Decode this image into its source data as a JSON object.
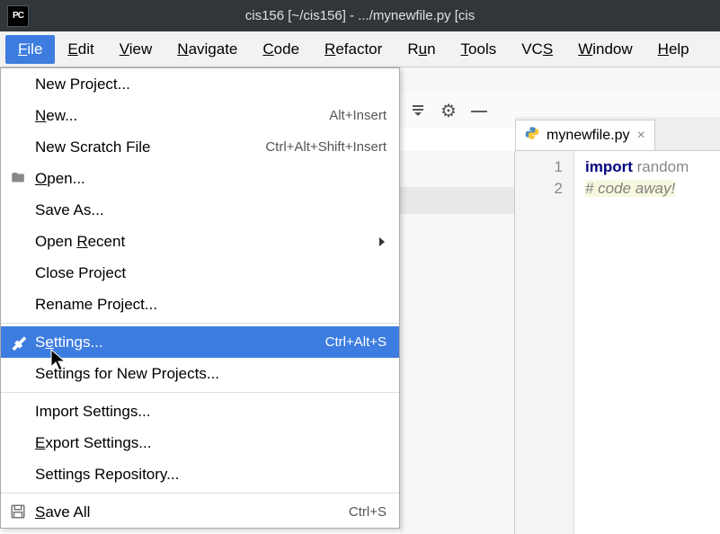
{
  "titlebar": {
    "app_icon_text": "PC",
    "text": "cis156 [~/cis156] - .../mynewfile.py [cis"
  },
  "menubar": {
    "items": [
      {
        "label": "File",
        "u": "F",
        "rest": "ile",
        "active": true
      },
      {
        "label": "Edit",
        "u": "E",
        "rest": "dit"
      },
      {
        "label": "View",
        "u": "V",
        "rest": "iew"
      },
      {
        "label": "Navigate",
        "u": "N",
        "rest": "avigate"
      },
      {
        "label": "Code",
        "u": "C",
        "rest": "ode"
      },
      {
        "label": "Refactor",
        "u": "R",
        "rest": "efactor"
      },
      {
        "label": "Run",
        "u": "u",
        "pre": "R",
        "rest": "n"
      },
      {
        "label": "Tools",
        "u": "T",
        "rest": "ools"
      },
      {
        "label": "VCS",
        "u": "S",
        "pre": "VC",
        "rest": ""
      },
      {
        "label": "Window",
        "u": "W",
        "rest": "indow"
      },
      {
        "label": "Help",
        "u": "H",
        "rest": "elp"
      }
    ]
  },
  "file_menu": {
    "items": [
      {
        "label": "New Project..."
      },
      {
        "u": "N",
        "rest": "ew...",
        "shortcut": "Alt+Insert"
      },
      {
        "label": "New Scratch File",
        "shortcut": "Ctrl+Alt+Shift+Insert"
      },
      {
        "u": "O",
        "rest": "pen...",
        "icon": "folder"
      },
      {
        "label": "Save As..."
      },
      {
        "pre": "Open ",
        "u": "R",
        "rest": "ecent",
        "submenu": true
      },
      {
        "label": "Close Project"
      },
      {
        "label": "Rename Project..."
      },
      {
        "sep": true
      },
      {
        "pre": "S",
        "u": "e",
        "rest": "ttings...",
        "shortcut": "Ctrl+Alt+S",
        "selected": true,
        "icon": "wrench"
      },
      {
        "label": "Settings for New Projects..."
      },
      {
        "sep": true
      },
      {
        "label": "Import Settings..."
      },
      {
        "u": "E",
        "rest": "xport Settings..."
      },
      {
        "label": "Settings Repository..."
      },
      {
        "sep": true
      },
      {
        "u": "S",
        "rest": "ave All",
        "shortcut": "Ctrl+S",
        "icon": "save"
      }
    ]
  },
  "toolbar": {
    "gear": "⚙",
    "minus": "—"
  },
  "editor_tab": {
    "filename": "mynewfile.py",
    "close": "×"
  },
  "gutter": {
    "lines": [
      "1",
      "2"
    ]
  },
  "code": {
    "l1_kw": "import",
    "l1_id": " random",
    "l2": "# code away!"
  }
}
